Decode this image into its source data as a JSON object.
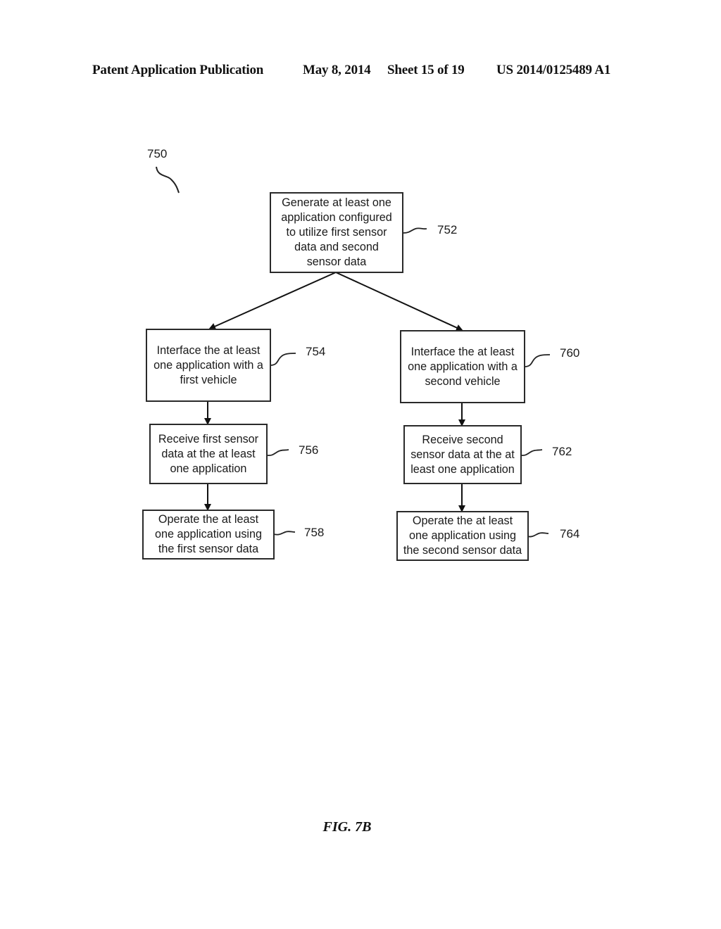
{
  "header": {
    "publication": "Patent Application Publication",
    "date": "May 8, 2014",
    "sheet": "Sheet 15 of 19",
    "patent_number": "US 2014/0125489 A1"
  },
  "diagram": {
    "figure_ref": "750",
    "nodes": [
      {
        "id": "752",
        "text": "Generate at least one\napplication configured\nto utilize first sensor\ndata and second\nsensor data"
      },
      {
        "id": "754",
        "text": "Interface the at least\none application with a\nfirst vehicle"
      },
      {
        "id": "756",
        "text": "Receive first sensor\ndata at the at least\none application"
      },
      {
        "id": "758",
        "text": "Operate the at least\none application using\nthe first sensor data"
      },
      {
        "id": "760",
        "text": "Interface the at least\none application with a\nsecond vehicle"
      },
      {
        "id": "762",
        "text": "Receive second\nsensor data at the at\nleast one application"
      },
      {
        "id": "764",
        "text": "Operate the at least\none application using\nthe second sensor data"
      }
    ],
    "edges": [
      [
        "752",
        "754"
      ],
      [
        "752",
        "760"
      ],
      [
        "754",
        "756"
      ],
      [
        "756",
        "758"
      ],
      [
        "760",
        "762"
      ],
      [
        "762",
        "764"
      ]
    ]
  },
  "caption": "FIG. 7B"
}
